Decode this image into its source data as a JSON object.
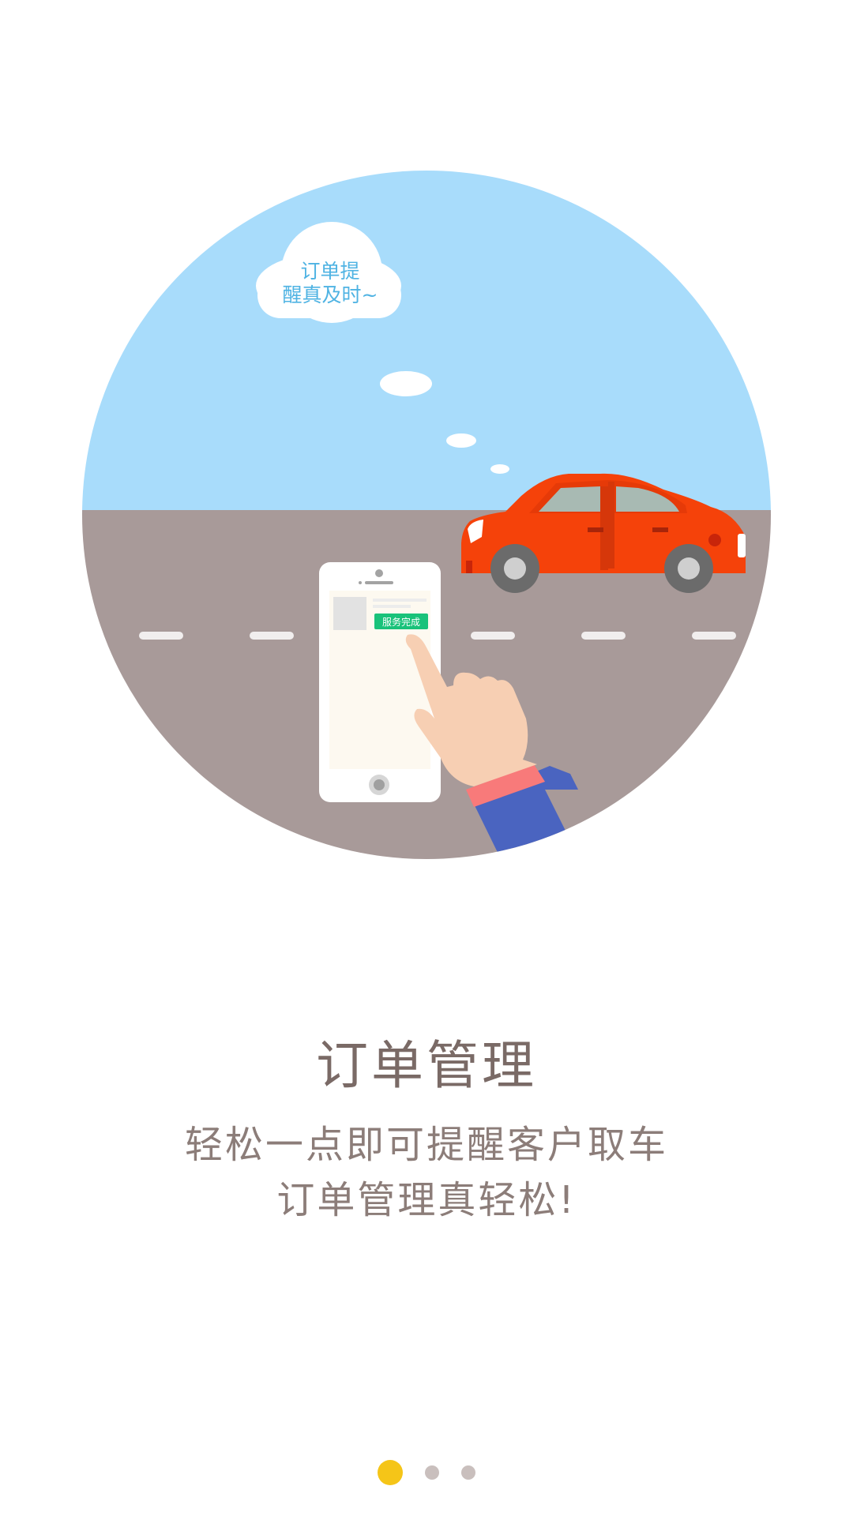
{
  "illustration": {
    "cloud_line1": "订单提",
    "cloud_line2": "醒真及时~",
    "phone_badge": "服务完成",
    "icon": "car-phone-illustration"
  },
  "intro": {
    "title": "订单管理",
    "subtitle_line1": "轻松一点即可提醒客户取车",
    "subtitle_line2": "订单管理真轻松!"
  },
  "pager": {
    "total": 3,
    "active_index": 0,
    "active_color": "#f5c518",
    "inactive_color": "#c9bfbd"
  },
  "colors": {
    "sky": "#a8dcfb",
    "road": "#a89a99",
    "car": "#f5420a",
    "badge": "#19c27a",
    "title_text": "#7a6a66"
  }
}
